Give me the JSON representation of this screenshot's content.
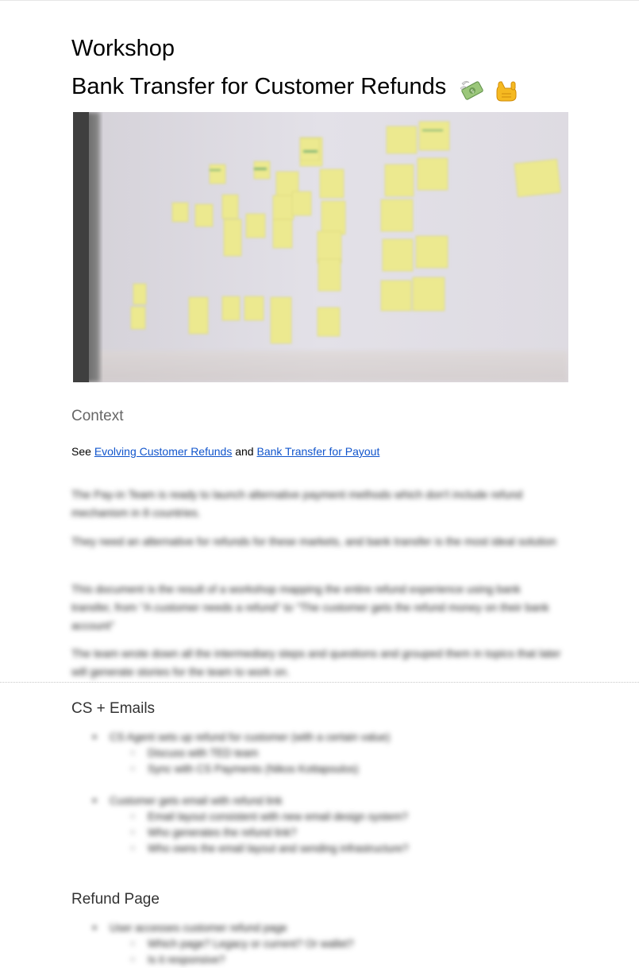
{
  "document": {
    "title_line_1": "Workshop",
    "title_line_2": "Bank Transfer for Customer Refunds",
    "title_emojis": [
      "money-with-wings-icon",
      "call-me-hand-icon"
    ]
  },
  "photo": {
    "subject": "wall-with-sticky-notes"
  },
  "context": {
    "heading": "Context",
    "see_prefix": "See ",
    "link_1": "Evolving Customer Refunds",
    "see_and": " and ",
    "link_2": "Bank Transfer for Payout",
    "paragraphs": [
      "The Pay-in Team is ready to launch alternative payment methods which don't include refund mechanism in 8 countries.",
      "They need an alternative for refunds for these markets, and bank transfer is the most ideal solution",
      "This document is the result of a workshop mapping the entire refund experience using bank transfer, from \"A customer needs a refund\" to \"The customer gets the refund money on their bank account\"",
      "The team wrote down all the intermediary steps and questions and grouped them in topics that later will generate stories for the team to work on."
    ]
  },
  "cs_emails": {
    "heading": "CS + Emails",
    "group_1": {
      "item": "CS Agent sets up refund for customer (with a certain value)",
      "sub": [
        "Discuss with TED team",
        "Sync with CS Payments (Nikos Kottapoulos)"
      ]
    },
    "group_2": {
      "item": "Customer gets email with refund link",
      "sub": [
        "Email layout consistent with new email design system?",
        "Who generates the refund link?",
        "Who owns the email layout and sending infrastructure?"
      ]
    }
  },
  "refund_page": {
    "heading": "Refund Page",
    "group_1": {
      "item": "User accesses customer refund page",
      "sub": [
        "Which page? Legacy or current? Or wallet?",
        "Is it responsive?"
      ]
    }
  }
}
